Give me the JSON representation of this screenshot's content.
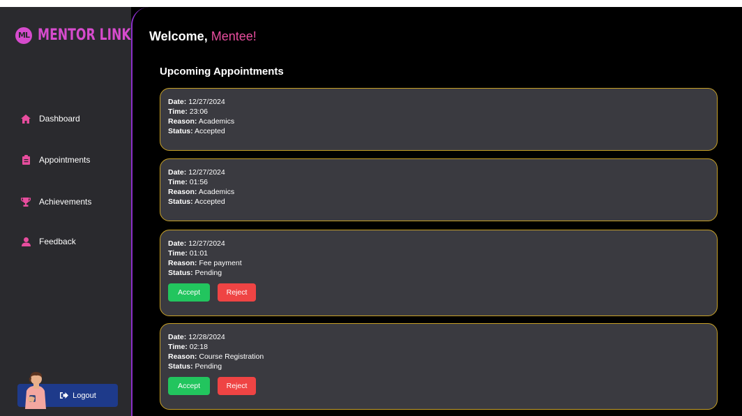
{
  "brand": {
    "name": "MENTOR LINK",
    "badge": "ML"
  },
  "sidebar": {
    "items": [
      {
        "label": "Dashboard",
        "icon": "home-icon"
      },
      {
        "label": "Appointments",
        "icon": "clipboard-icon"
      },
      {
        "label": "Achievements",
        "icon": "trophy-icon"
      },
      {
        "label": "Feedback",
        "icon": "user-icon"
      }
    ],
    "logout_label": "Logout"
  },
  "header": {
    "greeting": "Welcome,",
    "name": "Mentee!"
  },
  "section_title": "Upcoming Appointments",
  "field_labels": {
    "date": "Date:",
    "time": "Time:",
    "reason": "Reason:",
    "status": "Status:"
  },
  "buttons": {
    "accept": "Accept",
    "reject": "Reject"
  },
  "appointments": [
    {
      "date": "12/27/2024",
      "time": "23:06",
      "reason": "Academics",
      "status": "Accepted"
    },
    {
      "date": "12/27/2024",
      "time": "01:56",
      "reason": "Academics",
      "status": "Accepted"
    },
    {
      "date": "12/27/2024",
      "time": "01:01",
      "reason": "Fee payment",
      "status": "Pending"
    },
    {
      "date": "12/28/2024",
      "time": "02:18",
      "reason": "Course Registration",
      "status": "Pending"
    }
  ],
  "colors": {
    "accent_pink": "#d64bcd",
    "name_pink": "#e84d9e",
    "card_border": "#c9a227",
    "accept_green": "#22c55e",
    "reject_red": "#ef4444",
    "logout_blue": "#1e3a8a"
  }
}
